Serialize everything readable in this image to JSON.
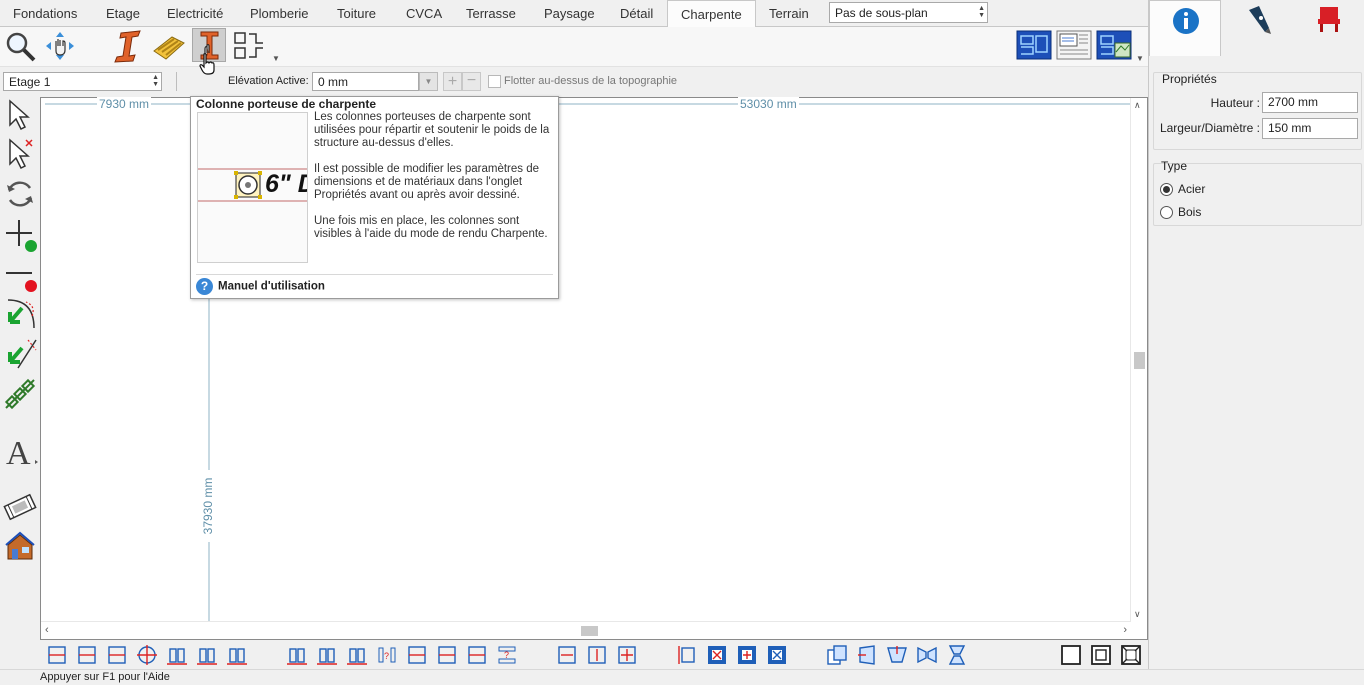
{
  "tabs": [
    {
      "label": "Fondations",
      "active": false
    },
    {
      "label": "Etage",
      "active": false
    },
    {
      "label": "Electricité",
      "active": false
    },
    {
      "label": "Plomberie",
      "active": false
    },
    {
      "label": "Toiture",
      "active": false
    },
    {
      "label": "CVCA",
      "active": false
    },
    {
      "label": "Terrasse",
      "active": false
    },
    {
      "label": "Paysage",
      "active": false
    },
    {
      "label": "Détail",
      "active": false
    },
    {
      "label": "Charpente",
      "active": true
    },
    {
      "label": "Terrain",
      "active": false
    }
  ],
  "subplan_select": {
    "value": "Pas de sous-plan"
  },
  "toolbar": {
    "icons": [
      "zoom-icon",
      "pan-hand-icon",
      "steel-beam-icon",
      "joist-icon",
      "framing-column-icon",
      "framing-tools-icon",
      "dropdown-arrow-icon",
      "plan-view-icon",
      "elevation-view-icon",
      "3d-view-icon",
      "dropdown-arrow-icon"
    ]
  },
  "options_bar": {
    "level_select": "Etage 1",
    "elevation_label": "Elévation Active:",
    "elevation_value": "0 mm",
    "float_label": "Flotter au-dessus de la topographie",
    "float_checked": false
  },
  "canvas": {
    "dim_top_left": "7930 mm",
    "dim_top_right": "53030 mm",
    "dim_vertical": "37930 mm"
  },
  "tooltip": {
    "title": "Colonne porteuse de charpente",
    "paragraphs": [
      "Les colonnes porteuses de charpente sont utilisées pour répartir et soutenir le poids de la structure au-dessus d'elles.",
      "Il est possible de modifier les paramètres de dimensions et de matériaux dans l'onglet Propriétés avant ou après avoir dessiné.",
      "Une fois mis en place, les colonnes sont visibles à l'aide du mode de rendu Charpente."
    ],
    "preview_label": "6\" D",
    "help_link": "Manuel d'utilisation"
  },
  "right_panel": {
    "tabs": [
      "info-icon",
      "pen-icon",
      "chair-icon"
    ],
    "properties": {
      "title": "Propriétés",
      "height_label": "Hauteur :",
      "height_value": "2700 mm",
      "width_label": "Largeur/Diamètre :",
      "width_value": "150 mm"
    },
    "type": {
      "title": "Type",
      "options": [
        {
          "label": "Acier",
          "checked": true
        },
        {
          "label": "Bois",
          "checked": false
        }
      ]
    }
  },
  "status_bar": {
    "text": "Appuyer sur F1 pour l'Aide"
  },
  "colors": {
    "accent_blue": "#1a73c6",
    "beam_orange": "#e0622a",
    "dimension": "#5f8fa8",
    "selection_red": "#d22"
  }
}
